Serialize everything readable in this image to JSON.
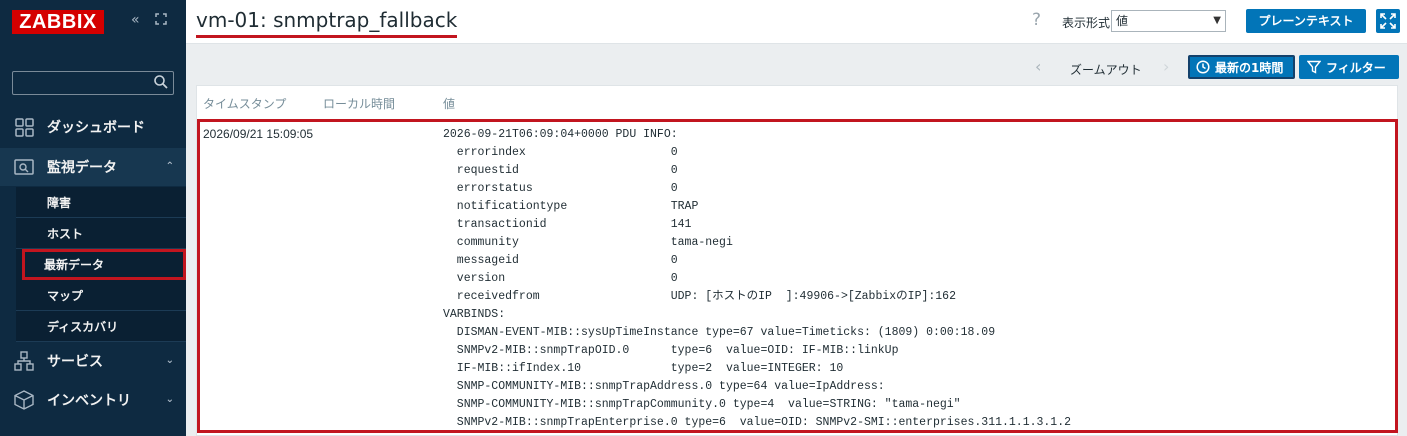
{
  "sidebar": {
    "logo": "ZABBIX",
    "collapse_icon": "«",
    "expand_icon": "⤢",
    "search_placeholder": "",
    "items": [
      {
        "label": "ダッシュボード",
        "icon": "dashboard-icon"
      },
      {
        "label": "監視データ",
        "icon": "monitoring-icon",
        "chevron": "⌃"
      },
      {
        "label": "サービス",
        "icon": "services-icon",
        "chevron": "⌄"
      },
      {
        "label": "インベントリ",
        "icon": "inventory-icon",
        "chevron": "⌄"
      }
    ],
    "sub_items": [
      {
        "label": "障害"
      },
      {
        "label": "ホスト"
      },
      {
        "label": "最新データ"
      },
      {
        "label": "マップ"
      },
      {
        "label": "ディスカバリ"
      }
    ]
  },
  "header": {
    "title": "vm-01: snmptrap_fallback",
    "help": "?",
    "format_label": "表示形式",
    "format_value": "値",
    "plain_text_button": "プレーンテキスト"
  },
  "toolbar": {
    "zoom_out": "ズームアウト",
    "time_tab": "最新の1時間",
    "filter_tab": "フィルター"
  },
  "table": {
    "columns": [
      "タイムスタンプ",
      "ローカル時間",
      "値"
    ],
    "row": {
      "timestamp": "2026/09/21 15:09:05",
      "local_time": "",
      "value_lines": [
        "2026-09-21T06:09:04+0000 PDU INFO:",
        "  errorindex                     0",
        "  requestid                      0",
        "  errorstatus                    0",
        "  notificationtype               TRAP",
        "  transactionid                  141",
        "  community                      tama-negi",
        "  messageid                      0",
        "  version                        0",
        "  receivedfrom                   UDP: [ホストのIP  ]:49906->[ZabbixのIP]:162",
        "VARBINDS:",
        "  DISMAN-EVENT-MIB::sysUpTimeInstance type=67 value=Timeticks: (1809) 0:00:18.09",
        "  SNMPv2-MIB::snmpTrapOID.0      type=6  value=OID: IF-MIB::linkUp",
        "  IF-MIB::ifIndex.10             type=2  value=INTEGER: 10",
        "  SNMP-COMMUNITY-MIB::snmpTrapAddress.0 type=64 value=IpAddress:",
        "  SNMP-COMMUNITY-MIB::snmpTrapCommunity.0 type=4  value=STRING: \"tama-negi\"",
        "  SNMPv2-MIB::snmpTrapEnterprise.0 type=6  value=OID: SNMPv2-SMI::enterprises.311.1.1.3.1.2"
      ]
    }
  },
  "colors": {
    "sidebar_bg": "#0e2a41",
    "accent_blue": "#0275b8",
    "highlight_red": "#c2151f",
    "logo_red": "#d40000"
  }
}
